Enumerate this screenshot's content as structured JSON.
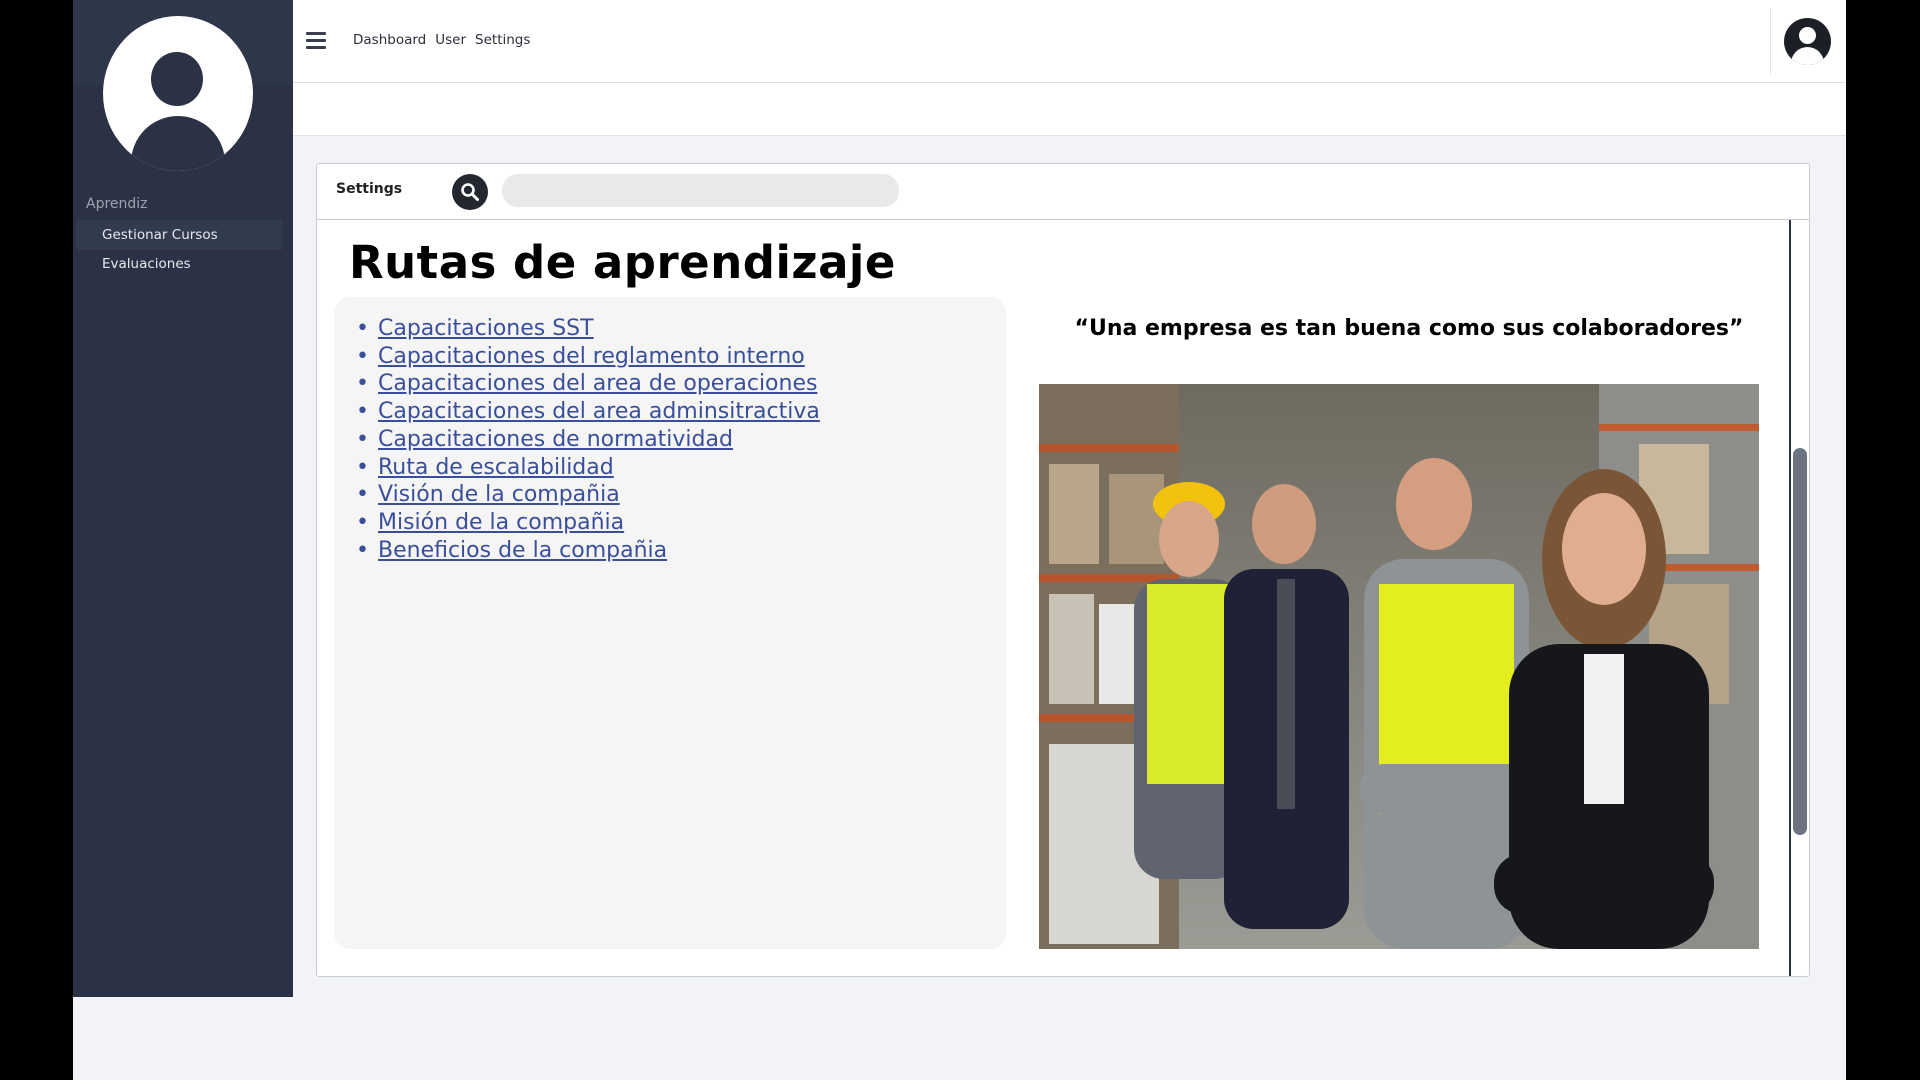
{
  "sidebar": {
    "section_label": "Aprendiz",
    "items": [
      {
        "label": "Gestionar Cursos",
        "active": true
      },
      {
        "label": "Evaluaciones",
        "active": false
      }
    ]
  },
  "topbar": {
    "nav": [
      "Dashboard",
      "User",
      "Settings"
    ]
  },
  "panel": {
    "header_title": "Settings",
    "search_placeholder": "",
    "page_title": "Rutas de aprendizaje",
    "links": [
      "Capacitaciones SST",
      "Capacitaciones del reglamento interno",
      "Capacitaciones del area de operaciones",
      "Capacitaciones del area adminsitractiva",
      "Capacitaciones de normatividad",
      "Ruta de escalabilidad",
      "Visión de la compañia",
      "Misión de la compañia",
      "Beneficios de la compañia"
    ],
    "quote": "“Una empresa es tan buena como sus colaboradores”"
  },
  "colors": {
    "sidebar_bg": "#2b3245",
    "link": "#3a4f9a",
    "page_bg": "#f2f3f7"
  },
  "icons": [
    "menu-icon",
    "search-icon",
    "user-avatar-icon"
  ]
}
